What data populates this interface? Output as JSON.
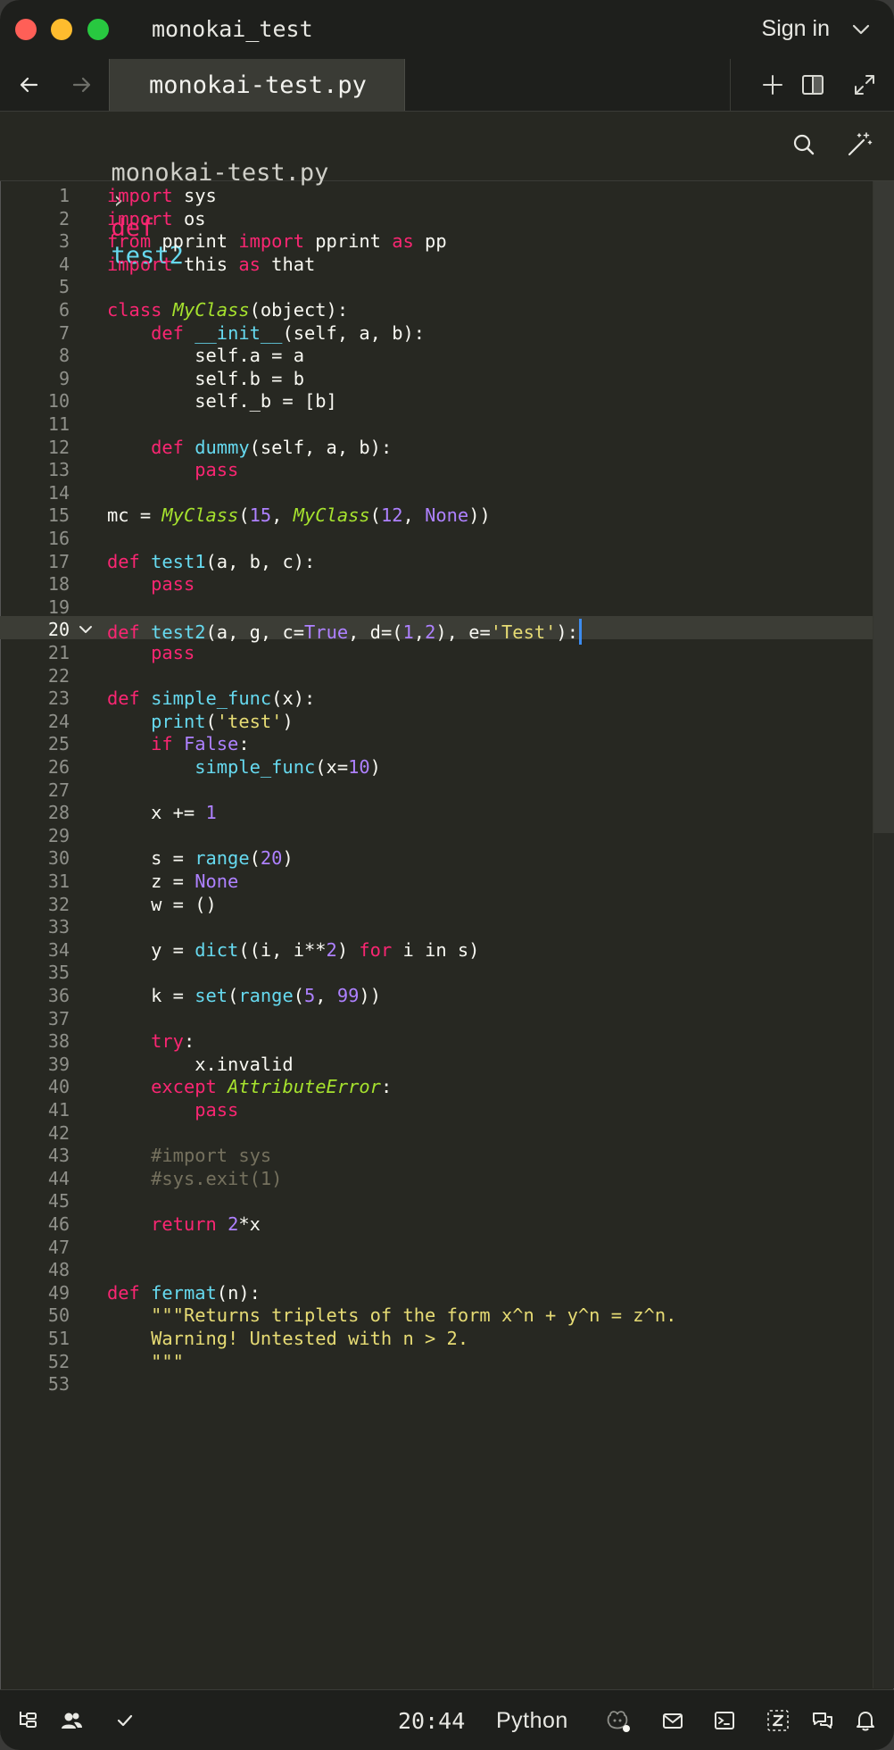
{
  "window": {
    "title": "monokai_test",
    "sign_in_label": "Sign in"
  },
  "tab": {
    "label": "monokai-test.py"
  },
  "breadcrumb": {
    "file": "monokai-test.py",
    "separator": "›",
    "keyword": "def",
    "function": "test2"
  },
  "editor": {
    "active_line": 20,
    "lines": [
      [
        [
          "kw",
          "import"
        ],
        [
          "p",
          " sys"
        ]
      ],
      [
        [
          "kw",
          "import"
        ],
        [
          "p",
          " os"
        ]
      ],
      [
        [
          "kw",
          "from"
        ],
        [
          "p",
          " pprint "
        ],
        [
          "kw",
          "import"
        ],
        [
          "p",
          " pprint "
        ],
        [
          "kw",
          "as"
        ],
        [
          "p",
          " pp"
        ]
      ],
      [
        [
          "kw",
          "import"
        ],
        [
          "p",
          " this "
        ],
        [
          "kw",
          "as"
        ],
        [
          "p",
          " that"
        ]
      ],
      [],
      [
        [
          "kw",
          "class"
        ],
        [
          "p",
          " "
        ],
        [
          "cls",
          "MyClass"
        ],
        [
          "p",
          "(object):"
        ]
      ],
      [
        [
          "p",
          "    "
        ],
        [
          "kw",
          "def"
        ],
        [
          "p",
          " "
        ],
        [
          "fn",
          "__init__"
        ],
        [
          "p",
          "(self, a, b):"
        ]
      ],
      [
        [
          "p",
          "        self.a = a"
        ]
      ],
      [
        [
          "p",
          "        self.b = b"
        ]
      ],
      [
        [
          "p",
          "        self._b = [b]"
        ]
      ],
      [],
      [
        [
          "p",
          "    "
        ],
        [
          "kw",
          "def"
        ],
        [
          "p",
          " "
        ],
        [
          "fn",
          "dummy"
        ],
        [
          "p",
          "(self, a, b):"
        ]
      ],
      [
        [
          "p",
          "        "
        ],
        [
          "kw",
          "pass"
        ]
      ],
      [],
      [
        [
          "p",
          "mc = "
        ],
        [
          "cls",
          "MyClass"
        ],
        [
          "p",
          "("
        ],
        [
          "num",
          "15"
        ],
        [
          "p",
          ", "
        ],
        [
          "cls",
          "MyClass"
        ],
        [
          "p",
          "("
        ],
        [
          "num",
          "12"
        ],
        [
          "p",
          ", "
        ],
        [
          "num",
          "None"
        ],
        [
          "p",
          "))"
        ]
      ],
      [],
      [
        [
          "kw",
          "def"
        ],
        [
          "p",
          " "
        ],
        [
          "fn",
          "test1"
        ],
        [
          "p",
          "(a, b, c):"
        ]
      ],
      [
        [
          "p",
          "    "
        ],
        [
          "kw",
          "pass"
        ]
      ],
      [],
      [
        [
          "kw",
          "def"
        ],
        [
          "p",
          " "
        ],
        [
          "fn",
          "test2"
        ],
        [
          "p",
          "(a, g, c="
        ],
        [
          "num",
          "True"
        ],
        [
          "p",
          ", d=("
        ],
        [
          "num",
          "1"
        ],
        [
          "p",
          ","
        ],
        [
          "num",
          "2"
        ],
        [
          "p",
          "), e="
        ],
        [
          "str",
          "'Test'"
        ],
        [
          "p",
          "):"
        ]
      ],
      [
        [
          "p",
          "    "
        ],
        [
          "kw",
          "pass"
        ]
      ],
      [],
      [
        [
          "kw",
          "def"
        ],
        [
          "p",
          " "
        ],
        [
          "fn",
          "simple_func"
        ],
        [
          "p",
          "(x):"
        ]
      ],
      [
        [
          "p",
          "    "
        ],
        [
          "fn",
          "print"
        ],
        [
          "p",
          "("
        ],
        [
          "str",
          "'test'"
        ],
        [
          "p",
          ")"
        ]
      ],
      [
        [
          "p",
          "    "
        ],
        [
          "kw",
          "if"
        ],
        [
          "p",
          " "
        ],
        [
          "num",
          "False"
        ],
        [
          "p",
          ":"
        ]
      ],
      [
        [
          "p",
          "        "
        ],
        [
          "fn",
          "simple_func"
        ],
        [
          "p",
          "(x="
        ],
        [
          "num",
          "10"
        ],
        [
          "p",
          ")"
        ]
      ],
      [],
      [
        [
          "p",
          "    x += "
        ],
        [
          "num",
          "1"
        ]
      ],
      [],
      [
        [
          "p",
          "    s = "
        ],
        [
          "fn",
          "range"
        ],
        [
          "p",
          "("
        ],
        [
          "num",
          "20"
        ],
        [
          "p",
          ")"
        ]
      ],
      [
        [
          "p",
          "    z = "
        ],
        [
          "num",
          "None"
        ]
      ],
      [
        [
          "p",
          "    w = ()"
        ]
      ],
      [],
      [
        [
          "p",
          "    y = "
        ],
        [
          "fn",
          "dict"
        ],
        [
          "p",
          "((i, i**"
        ],
        [
          "num",
          "2"
        ],
        [
          "p",
          ") "
        ],
        [
          "kw",
          "for"
        ],
        [
          "p",
          " i in s)"
        ]
      ],
      [],
      [
        [
          "p",
          "    k = "
        ],
        [
          "fn",
          "set"
        ],
        [
          "p",
          "("
        ],
        [
          "fn",
          "range"
        ],
        [
          "p",
          "("
        ],
        [
          "num",
          "5"
        ],
        [
          "p",
          ", "
        ],
        [
          "num",
          "99"
        ],
        [
          "p",
          "))"
        ]
      ],
      [],
      [
        [
          "p",
          "    "
        ],
        [
          "kw",
          "try"
        ],
        [
          "p",
          ":"
        ]
      ],
      [
        [
          "p",
          "        x.invalid"
        ]
      ],
      [
        [
          "p",
          "    "
        ],
        [
          "kw",
          "except"
        ],
        [
          "p",
          " "
        ],
        [
          "cls",
          "AttributeError"
        ],
        [
          "p",
          ":"
        ]
      ],
      [
        [
          "p",
          "        "
        ],
        [
          "kw",
          "pass"
        ]
      ],
      [],
      [
        [
          "p",
          "    "
        ],
        [
          "cm",
          "#import sys"
        ]
      ],
      [
        [
          "p",
          "    "
        ],
        [
          "cm",
          "#sys.exit(1)"
        ]
      ],
      [],
      [
        [
          "p",
          "    "
        ],
        [
          "kw",
          "return"
        ],
        [
          "p",
          " "
        ],
        [
          "num",
          "2"
        ],
        [
          "p",
          "*x"
        ]
      ],
      [],
      [],
      [
        [
          "kw",
          "def"
        ],
        [
          "p",
          " "
        ],
        [
          "fn",
          "fermat"
        ],
        [
          "p",
          "(n):"
        ]
      ],
      [
        [
          "p",
          "    "
        ],
        [
          "str",
          "\"\"\"Returns triplets of the form x^n + y^n = z^n."
        ]
      ],
      [
        [
          "str",
          "    Warning! Untested with n > 2."
        ]
      ],
      [
        [
          "str",
          "    \"\"\""
        ]
      ],
      []
    ]
  },
  "status": {
    "cursor_position": "20:44",
    "language": "Python"
  },
  "icons": {
    "close": "#ff5f57",
    "minimize": "#febc2e",
    "zoom": "#28c840",
    "accent": "#3c8cf0"
  }
}
